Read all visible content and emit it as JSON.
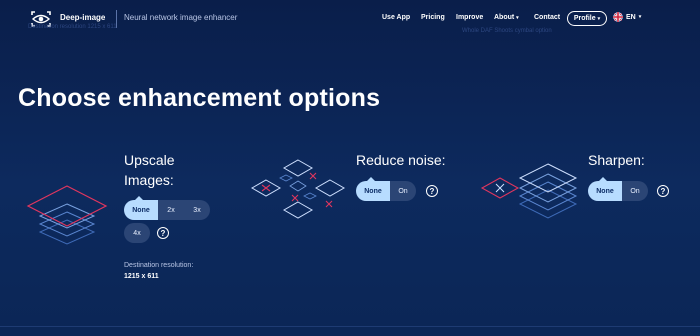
{
  "header": {
    "brand": "Deep-image",
    "tagline": "Neural network image enhancer",
    "ghost_left": "Destination resolution 1215 x 611",
    "ghost_right": "Whole DAF Shoots cymbal option",
    "nav": [
      "Use App",
      "Pricing",
      "Improve",
      "About",
      "Contact"
    ],
    "about_caret": "▾",
    "profile_label": "Profile",
    "profile_caret": "▾",
    "language": "EN",
    "language_caret": "▾"
  },
  "main": {
    "title": "Choose enhancement options",
    "upscale": {
      "label_line1": "Upscale",
      "label_line2": "Images:",
      "options_row1": [
        "None",
        "2x",
        "3x"
      ],
      "options_row2": [
        "4x"
      ],
      "selected": "None",
      "destination_label": "Destination resolution:",
      "destination_value": "1215 x 611"
    },
    "noise": {
      "label": "Reduce noise:",
      "options": [
        "None",
        "On"
      ],
      "selected": "None"
    },
    "sharpen": {
      "label": "Sharpen:",
      "options": [
        "None",
        "On"
      ],
      "selected": "None"
    },
    "help_glyph": "?"
  },
  "colors": {
    "background": "#0d2a5e",
    "accent_active": "#b7dcff",
    "segment_inactive": "#2b4575",
    "illustration_red": "#e0365e",
    "illustration_blue": "#8fb3ea"
  },
  "icons": {
    "logo": "eye-icon",
    "flag": "uk-flag-icon",
    "help": "question-circle-icon"
  }
}
